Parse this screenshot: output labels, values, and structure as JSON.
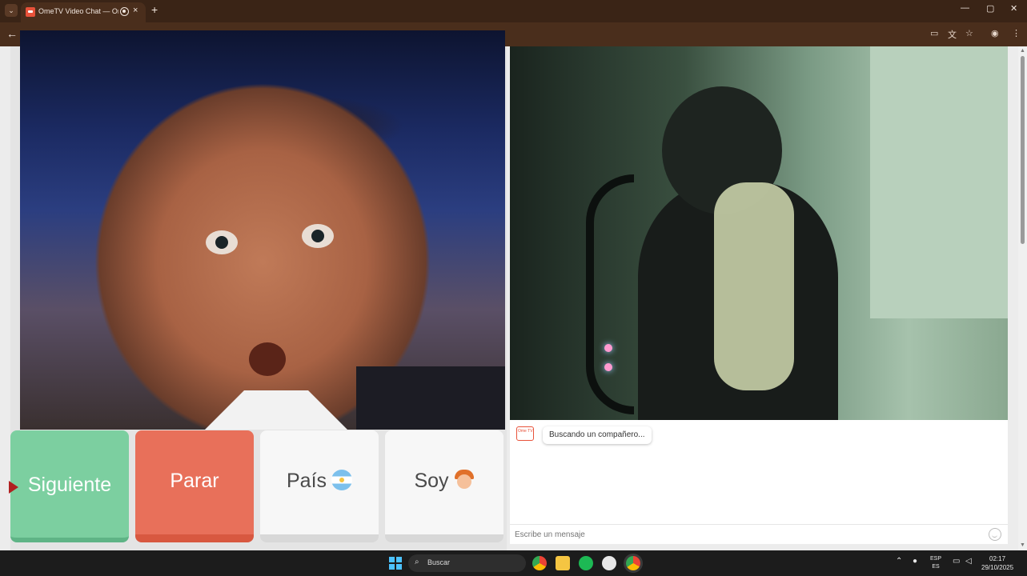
{
  "browser": {
    "tab_title": "OmeTV Video Chat — Ome",
    "tab_close": "×",
    "new_tab": "+",
    "back": "←",
    "window_controls": {
      "minimize": "—",
      "maximize": "▢",
      "close": "✕"
    }
  },
  "controls": {
    "next_label": "Siguiente",
    "stop_label": "Parar",
    "country_label": "País",
    "gender_label": "Soy"
  },
  "chat": {
    "logo_text": "Ome TV",
    "status_message": "Buscando un compañero...",
    "input_placeholder": "Escribe un mensaje"
  },
  "taskbar": {
    "search_label": "Buscar",
    "language_line1": "ESP",
    "language_line2": "ES",
    "time": "02:17",
    "date": "29/10/2025"
  },
  "colors": {
    "next_button": "#7ccfa0",
    "stop_button": "#e8705a",
    "neutral_button": "#f7f7f7",
    "brand": "#e8523a"
  }
}
